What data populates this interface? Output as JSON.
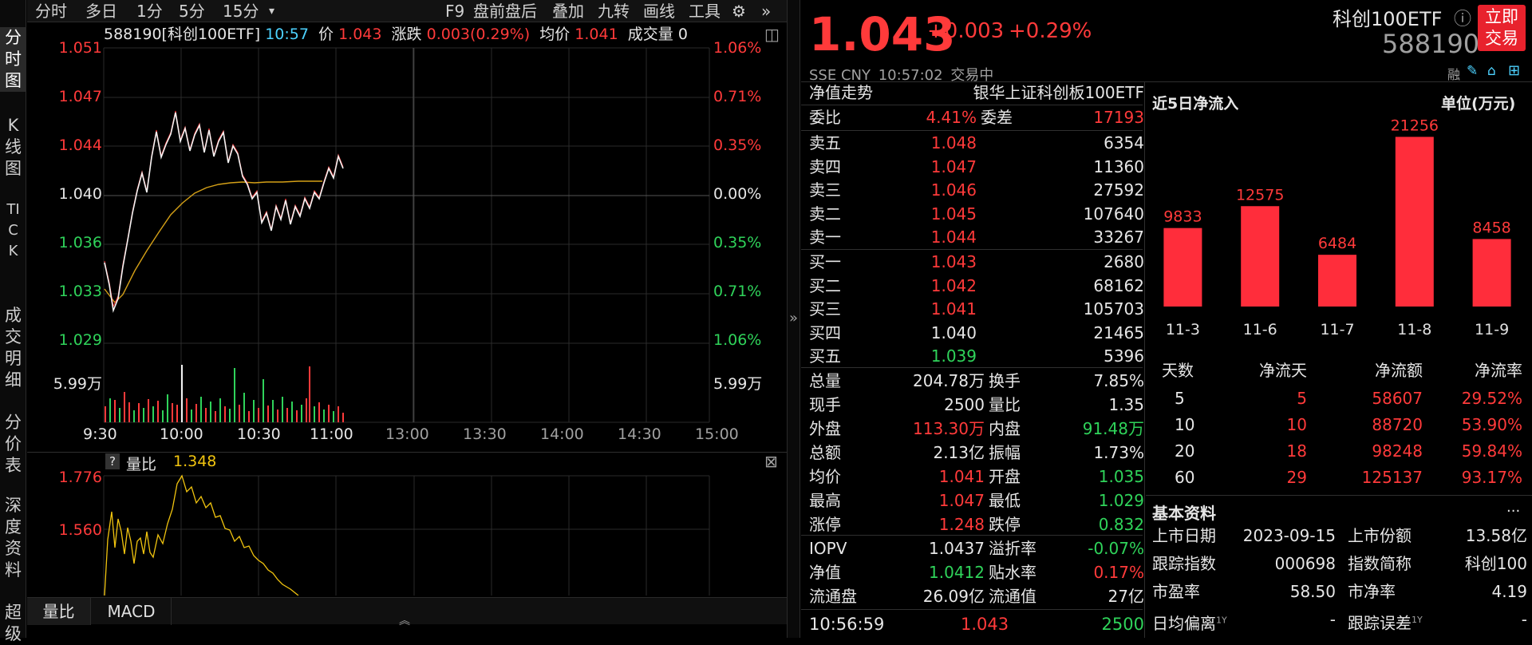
{
  "left_tabs": [
    "分时图",
    "K线图",
    "TICK",
    "成交明细",
    "分价表",
    "深度资料",
    "超级"
  ],
  "toolbar": {
    "left": [
      "分时",
      "多日",
      "1分",
      "5分",
      "15分"
    ],
    "right": [
      "F9",
      "盘前盘后",
      "叠加",
      "九转",
      "画线",
      "工具"
    ]
  },
  "info_bar": {
    "code": "588190[科创100ETF]",
    "time": "10:57",
    "price_label": "价",
    "price": "1.043",
    "change_label": "涨跌",
    "change": "0.003(0.29%)",
    "avg_label": "均价",
    "avg": "1.041",
    "vol_label": "成交量",
    "vol": "0"
  },
  "price_axis": [
    "1.051",
    "1.047",
    "1.044",
    "1.040",
    "1.036",
    "1.033",
    "1.029"
  ],
  "pct_axis": [
    "1.06%",
    "0.71%",
    "0.35%",
    "0.00%",
    "0.35%",
    "0.71%",
    "1.06%"
  ],
  "vol_axis": "5.99万",
  "time_axis": [
    "9:30",
    "10:00",
    "10:30",
    "11:00",
    "13:00",
    "13:30",
    "14:00",
    "14:30",
    "15:00"
  ],
  "sub": {
    "help": "?",
    "name": "量比",
    "value": "1.348",
    "ticks": [
      "1.776",
      "1.560"
    ]
  },
  "bottom_tabs": [
    "量比",
    "MACD"
  ],
  "quote": {
    "price": "1.043",
    "change": "+0.003",
    "pct": "+0.29%",
    "name": "科创100ETF",
    "code": "588190",
    "trade_btn": "立即交易",
    "exchange": "SSE",
    "currency": "CNY",
    "time": "10:57:02",
    "status": "交易中",
    "rong": "融"
  },
  "nav": {
    "label": "净值走势",
    "name": "银华上证科创板100ETF"
  },
  "weibi": {
    "label1": "委比",
    "v1": "4.41%",
    "label2": "委差",
    "v2": "17193"
  },
  "sells": [
    {
      "l": "卖五",
      "p": "1.048",
      "v": "6354"
    },
    {
      "l": "卖四",
      "p": "1.047",
      "v": "11360"
    },
    {
      "l": "卖三",
      "p": "1.046",
      "v": "27592"
    },
    {
      "l": "卖二",
      "p": "1.045",
      "v": "107640"
    },
    {
      "l": "卖一",
      "p": "1.044",
      "v": "33267"
    }
  ],
  "buys": [
    {
      "l": "买一",
      "p": "1.043",
      "v": "2680"
    },
    {
      "l": "买二",
      "p": "1.042",
      "v": "68162"
    },
    {
      "l": "买三",
      "p": "1.041",
      "v": "105703"
    },
    {
      "l": "买四",
      "p": "1.040",
      "v": "21465"
    },
    {
      "l": "买五",
      "p": "1.039",
      "v": "5396"
    }
  ],
  "stats": [
    [
      "总量",
      "204.78万",
      "换手",
      "7.85%"
    ],
    [
      "现手",
      "2500",
      "量比",
      "1.35"
    ],
    [
      "外盘",
      "113.30万",
      "内盘",
      "91.48万"
    ],
    [
      "总额",
      "2.13亿",
      "振幅",
      "1.73%"
    ],
    [
      "均价",
      "1.041",
      "开盘",
      "1.035"
    ],
    [
      "最高",
      "1.047",
      "最低",
      "1.029"
    ],
    [
      "涨停",
      "1.248",
      "跌停",
      "0.832"
    ]
  ],
  "iopv": [
    [
      "IOPV",
      "1.0437",
      "溢折率",
      "-0.07%"
    ],
    [
      "净值",
      "1.0412",
      "贴水率",
      "0.17%"
    ],
    [
      "流通盘",
      "26.09亿",
      "流通值",
      "27亿"
    ]
  ],
  "last_trade": {
    "time": "10:56:59",
    "price": "1.043",
    "vol": "2500"
  },
  "flow": {
    "title": "近5日净流入",
    "unit": "单位(万元)"
  },
  "chart_data": {
    "type": "bar",
    "categories": [
      "11-3",
      "11-6",
      "11-7",
      "11-8",
      "11-9"
    ],
    "values": [
      9833,
      12575,
      6484,
      21256,
      8458
    ],
    "title": "近5日净流入",
    "ylabel": "单位(万元)",
    "ylim": [
      0,
      23000
    ]
  },
  "flow_table": {
    "headers": [
      "天数",
      "净流天",
      "净流额",
      "净流率"
    ],
    "rows": [
      [
        "5",
        "5",
        "58607",
        "29.52%"
      ],
      [
        "10",
        "10",
        "88720",
        "53.90%"
      ],
      [
        "20",
        "18",
        "98248",
        "59.84%"
      ],
      [
        "60",
        "29",
        "125137",
        "93.17%"
      ]
    ]
  },
  "basic": {
    "title": "基本资料",
    "more": "...",
    "rows": [
      [
        "上市日期",
        "2023-09-15",
        "上市份额",
        "13.58亿"
      ],
      [
        "跟踪指数",
        "000698",
        "指数简称",
        "科创100"
      ],
      [
        "市盈率",
        "58.50",
        "市净率",
        "4.19"
      ],
      [
        "日均偏离",
        "-",
        "跟踪误差",
        "-"
      ]
    ],
    "sup": "1Y"
  },
  "colors": {
    "up": "#ff3a3a",
    "down": "#2fd35a",
    "bar": "#ff2d3b",
    "avg": "#f1c40f"
  }
}
